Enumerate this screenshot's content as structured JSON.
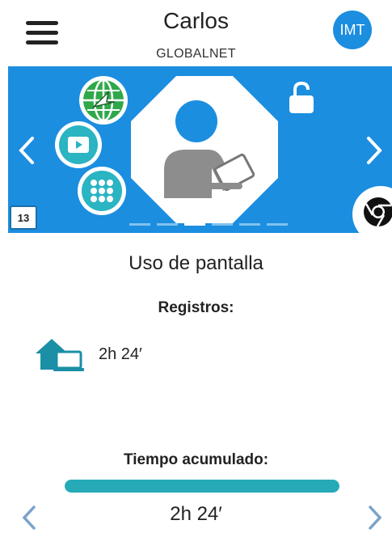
{
  "header": {
    "title": "Carlos",
    "subtitle": "GLOBALNET",
    "avatar_initials": "IMT"
  },
  "banner": {
    "calendar_day": "13",
    "dots_count": 6,
    "active_dot_index": 2,
    "background_color": "#1b8ee0"
  },
  "content": {
    "section_title": "Uso de pantalla",
    "registros_label": "Registros:",
    "registros": [
      {
        "icon": "home-laptop-icon",
        "time": "2h 24′"
      }
    ],
    "accumulated_label": "Tiempo acumulado:",
    "accumulated_time": "2h 24′",
    "accumulated_progress": 1.0,
    "accent_color": "#26aab8"
  }
}
